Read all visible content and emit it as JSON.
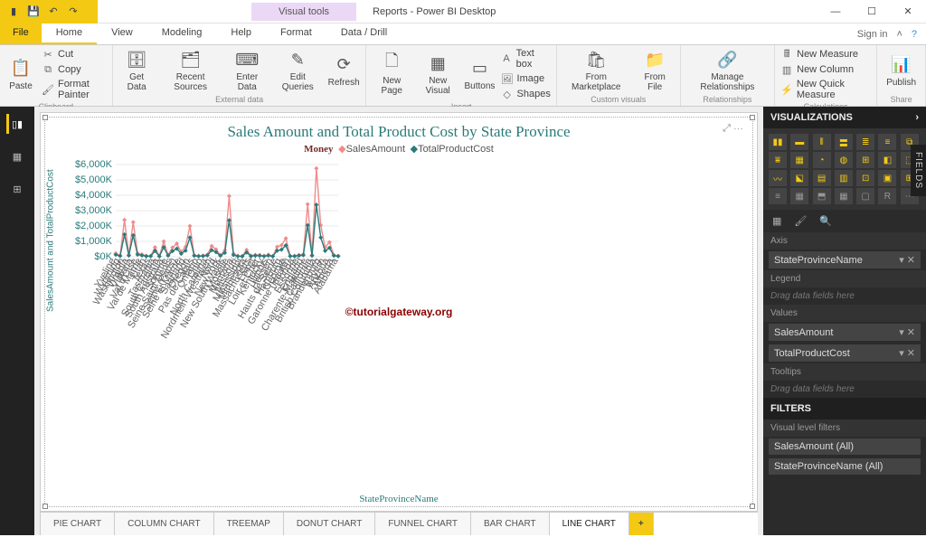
{
  "window": {
    "title": "Reports - Power BI Desktop",
    "visual_tools": "Visual tools",
    "sign_in": "Sign in"
  },
  "menu": {
    "file": "File",
    "items": [
      "Home",
      "View",
      "Modeling",
      "Help",
      "Format",
      "Data / Drill"
    ]
  },
  "ribbon": {
    "clipboard": {
      "label": "Clipboard",
      "paste": "Paste",
      "cut": "Cut",
      "copy": "Copy",
      "format_painter": "Format Painter"
    },
    "external": {
      "label": "External data",
      "get_data": "Get\nData",
      "recent": "Recent\nSources",
      "enter": "Enter\nData",
      "edit_q": "Edit\nQueries",
      "refresh": "Refresh"
    },
    "insert": {
      "label": "Insert",
      "new_page": "New\nPage",
      "new_visual": "New\nVisual",
      "buttons": "Buttons",
      "text_box": "Text box",
      "image": "Image",
      "shapes": "Shapes"
    },
    "custom": {
      "label": "Custom visuals",
      "marketplace": "From\nMarketplace",
      "file": "From\nFile"
    },
    "relationships": {
      "label": "Relationships",
      "manage": "Manage\nRelationships"
    },
    "calc": {
      "label": "Calculations",
      "new_measure": "New Measure",
      "new_column": "New Column",
      "quick": "New Quick Measure"
    },
    "share": {
      "label": "Share",
      "publish": "Publish"
    }
  },
  "pages": [
    "PIE CHART",
    "COLUMN CHART",
    "TREEMAP",
    "DONUT CHART",
    "FUNNEL CHART",
    "BAR CHART",
    "LINE CHART"
  ],
  "viz_panel": {
    "title": "VISUALIZATIONS",
    "axis_label": "Axis",
    "axis_field": "StateProvinceName",
    "legend_label": "Legend",
    "legend_drop": "Drag data fields here",
    "values_label": "Values",
    "value1": "SalesAmount",
    "value2": "TotalProductCost",
    "tooltips_label": "Tooltips",
    "tooltips_drop": "Drag data fields here",
    "filters_title": "FILTERS",
    "visual_filters": "Visual level filters",
    "filter1": "SalesAmount (All)",
    "filter2": "StateProvinceName (All)"
  },
  "fields_tab": "FIELDS",
  "watermark": "©tutorialgateway.org",
  "chart_data": {
    "type": "line",
    "title": "Sales Amount and Total Product Cost by State Province",
    "legend_title": "Money",
    "xlabel": "StateProvinceName",
    "ylabel": "SalesAmount and TotalProductCost",
    "ylim": [
      0,
      6000
    ],
    "yticks": [
      0,
      1000,
      2000,
      3000,
      4000,
      5000,
      6000
    ],
    "ytick_labels": [
      "$0K",
      "$1,000K",
      "$2,000K",
      "$3,000K",
      "$4,000K",
      "$5,000K",
      "$6,000K"
    ],
    "categories": [
      "Yveline",
      "Wyoming",
      "Washington",
      "Virginia",
      "Victoria",
      "Val d'Oise",
      "Val de Marne",
      "Utah",
      "Texas",
      "Tasmania",
      "South Carolina",
      "South Australia",
      "Somme",
      "Seine Saint Denis",
      "Seine (Paris)",
      "Seine et Marne",
      "Saarland",
      "Oregon",
      "Pas de Calais",
      "Ontario",
      "Ohio",
      "North Carolina",
      "Nordrhein-Westfalen",
      "Nord",
      "New York",
      "New South Wales",
      "Moselle",
      "Montana",
      "Missouri",
      "Mississippi",
      "Minnesota",
      "Massachusetts",
      "Loiret",
      "Loir et Cher",
      "Kentucky",
      "Illinois",
      "Hessen",
      "Hauts de Seine",
      "Hamburg",
      "Georgia",
      "Garonne (Haute)",
      "Florida",
      "Essonne",
      "England",
      "Charente-Maritime",
      "California",
      "British Columbia",
      "Brandenburg",
      "Bayern",
      "Arizona",
      "Alberta",
      "Alabama"
    ],
    "series": [
      {
        "name": "SalesAmount",
        "color": "#f08b8b",
        "values": [
          220,
          80,
          2400,
          120,
          2250,
          230,
          150,
          60,
          50,
          620,
          40,
          1000,
          110,
          600,
          850,
          320,
          650,
          2000,
          100,
          60,
          70,
          140,
          700,
          480,
          100,
          420,
          3950,
          200,
          50,
          40,
          450,
          60,
          120,
          110,
          50,
          130,
          40,
          650,
          750,
          1200,
          50,
          60,
          120,
          160,
          3420,
          110,
          5750,
          2050,
          610,
          950,
          110,
          60
        ]
      },
      {
        "name": "TotalProductCost",
        "color": "#2a7a7a",
        "values": [
          130,
          50,
          1450,
          80,
          1400,
          140,
          90,
          40,
          35,
          380,
          30,
          620,
          70,
          370,
          530,
          200,
          400,
          1250,
          65,
          40,
          45,
          90,
          430,
          300,
          65,
          260,
          2370,
          120,
          35,
          28,
          280,
          40,
          75,
          70,
          35,
          80,
          28,
          400,
          460,
          740,
          35,
          40,
          75,
          100,
          2050,
          70,
          3380,
          1250,
          380,
          580,
          70,
          40
        ]
      }
    ]
  }
}
